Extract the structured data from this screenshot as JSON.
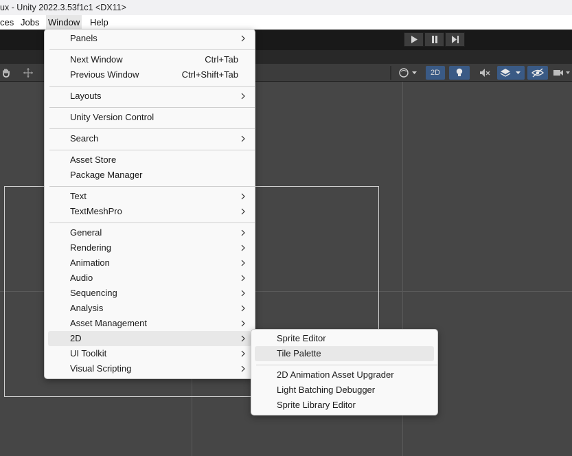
{
  "window": {
    "title": "ux - Unity 2022.3.53f1c1 <DX11>"
  },
  "menubar": [
    {
      "label": "ces"
    },
    {
      "label": "Jobs"
    },
    {
      "label": "Window"
    },
    {
      "label": "Help"
    }
  ],
  "scene_toolbar": {
    "mode_2d": "2D"
  },
  "window_menu": {
    "items": [
      {
        "label": "Panels",
        "submenu": true
      },
      {
        "label": "Next Window",
        "shortcut": "Ctrl+Tab"
      },
      {
        "label": "Previous Window",
        "shortcut": "Ctrl+Shift+Tab"
      },
      {
        "label": "Layouts",
        "submenu": true
      },
      {
        "label": "Unity Version Control"
      },
      {
        "label": "Search",
        "submenu": true
      },
      {
        "label": "Asset Store"
      },
      {
        "label": "Package Manager"
      },
      {
        "label": "Text",
        "submenu": true
      },
      {
        "label": "TextMeshPro",
        "submenu": true
      },
      {
        "label": "General",
        "submenu": true
      },
      {
        "label": "Rendering",
        "submenu": true
      },
      {
        "label": "Animation",
        "submenu": true
      },
      {
        "label": "Audio",
        "submenu": true
      },
      {
        "label": "Sequencing",
        "submenu": true
      },
      {
        "label": "Analysis",
        "submenu": true
      },
      {
        "label": "Asset Management",
        "submenu": true
      },
      {
        "label": "2D",
        "submenu": true,
        "highlighted": true
      },
      {
        "label": "UI Toolkit",
        "submenu": true
      },
      {
        "label": "Visual Scripting",
        "submenu": true
      }
    ]
  },
  "submenu_2d": {
    "items": [
      {
        "label": "Sprite Editor"
      },
      {
        "label": "Tile Palette",
        "highlighted": true
      },
      {
        "label": "2D Animation Asset Upgrader"
      },
      {
        "label": "Light Batching Debugger"
      },
      {
        "label": "Sprite Library Editor"
      }
    ]
  }
}
